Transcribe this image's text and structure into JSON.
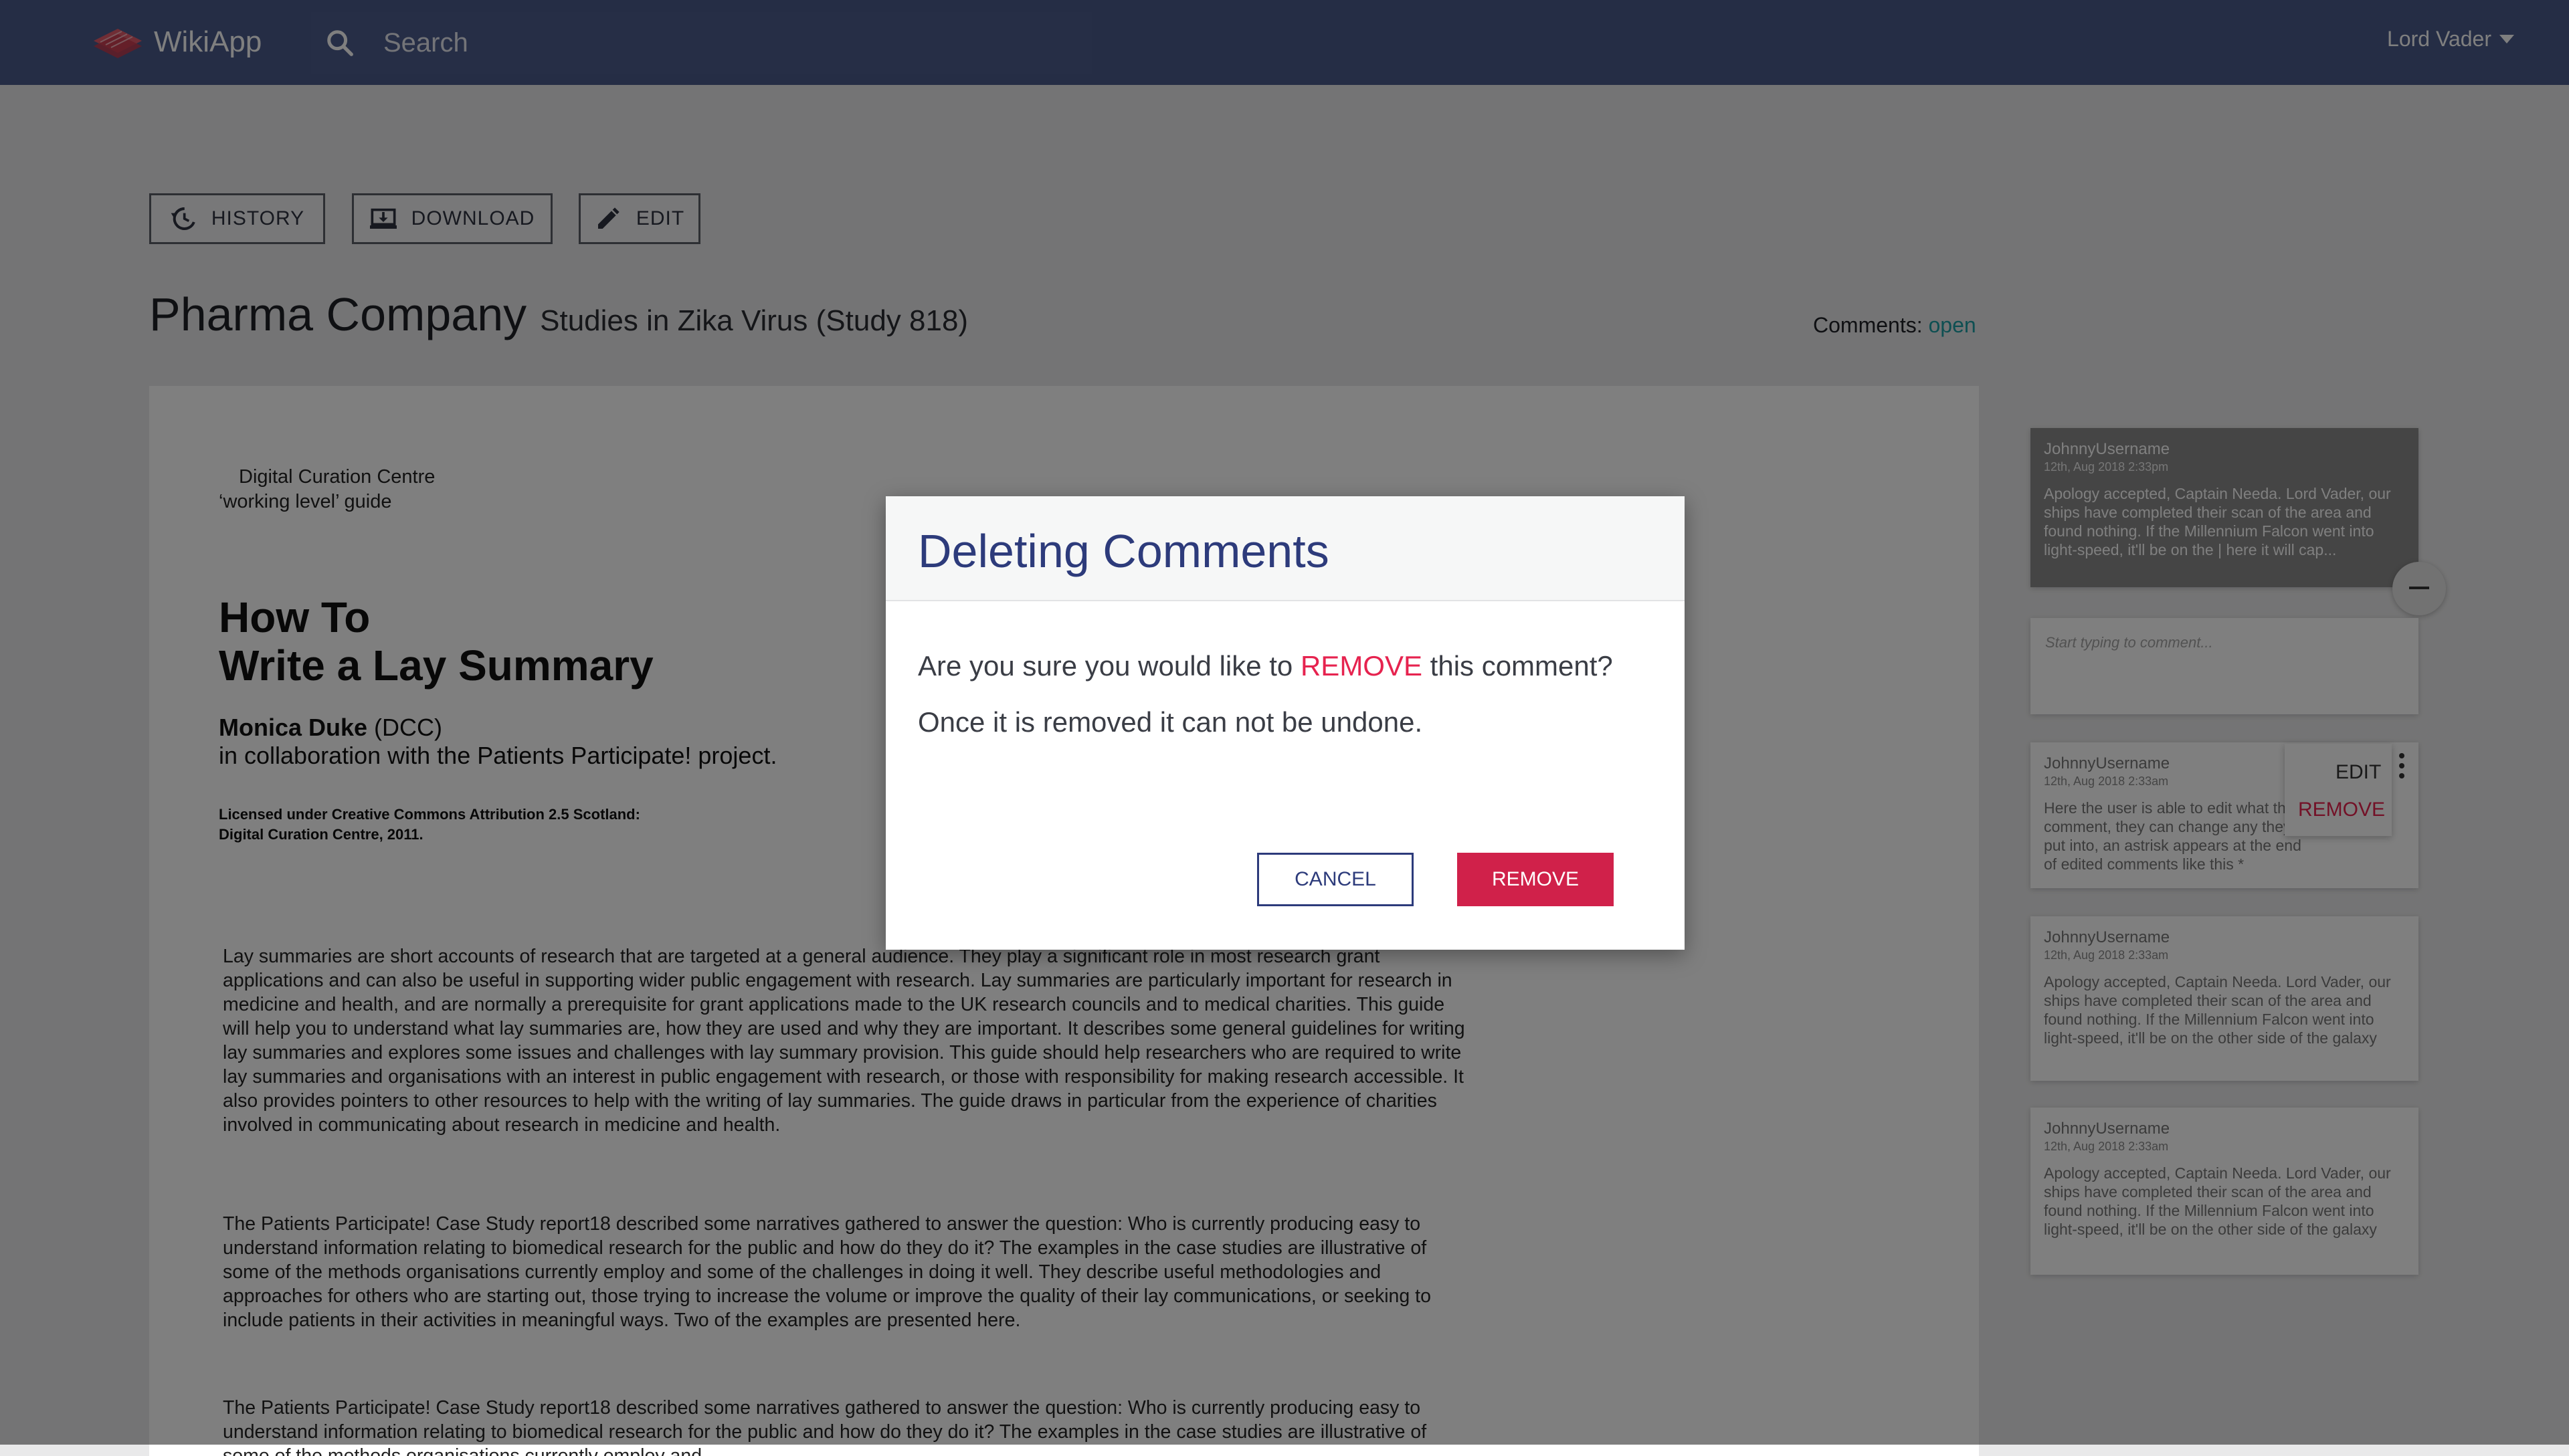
{
  "topbar": {
    "app_name": "WikiApp",
    "search_placeholder": "Search",
    "user_name": "Lord Vader"
  },
  "toolbar": {
    "history_label": "HISTORY",
    "download_label": "DOWNLOAD",
    "edit_label": "EDIT"
  },
  "page": {
    "title": "Pharma Company",
    "subtitle": "Studies in Zika Virus (Study 818)",
    "comments_label": "Comments:",
    "comments_status": "open"
  },
  "document": {
    "org_line1": "Digital Curation Centre",
    "org_line2": "‘working level’ guide",
    "title_line1": "How To",
    "title_line2": "Write a Lay Summary",
    "author_name": "Monica Duke",
    "author_org": " (DCC)",
    "collab": "in collaboration with the Patients Participate! project.",
    "license_line1": "Licensed under Creative Commons Attribution 2.5 Scotland:",
    "license_line2": "Digital Curation Centre, 2011.",
    "paragraphs": [
      "Lay summaries are short accounts of research that are targeted at a general audience. They play a significant role in most research grant applications and can also be useful in supporting wider public engagement with research. Lay summaries are particularly important for research in medicine and health, and are normally a prerequisite for grant applications made to the UK research councils and to medical charities. This guide will help you to understand what lay summaries are, how they are used and why they are important. It describes some general guidelines for writing lay summaries and explores some issues and challenges with lay summary provision. This guide should help researchers who are required to write lay summaries and organisations with an interest in public engagement with research, or those with responsibility for making research accessible. It also provides pointers to other resources to help with the writing of lay summaries. The guide draws in particular from the experience of charities involved in communicating about research in medicine and health.",
      "The Patients Participate! Case Study report18 described some narratives gathered to answer the question: Who is currently producing easy to understand information relating to biomedical research for the public and how do they do it? The examples in the case studies are illustrative of some of the methods organisations currently employ and some of the challenges in doing it well. They describe useful methodologies and approaches for others who are starting out, those trying to increase the volume or improve the quality of their lay communications, or seeking to include patients in their activities in meaningful ways. Two of the examples are presented here.",
      "The Patients Participate! Case Study report18 described some narratives gathered to answer the question: Who is currently producing easy to understand information relating to biomedical research for the public and how do they do it? The examples in the case studies are illustrative of some of the methods organisations currently employ and"
    ]
  },
  "comments": {
    "reply_placeholder": "Start typing to comment...",
    "menu_edit": "EDIT",
    "menu_remove": "REMOVE",
    "items": [
      {
        "user": "JohnnyUsername",
        "date": "12th, Aug 2018 2:33pm",
        "text": "Apology accepted, Captain Needa. Lord Vader, our ships have completed their scan of the area and found nothing. If the Millennium Falcon went into light-speed, it'll be on the | here it will cap..."
      },
      {
        "user": "JohnnyUsername",
        "date": "12th, Aug 2018 2:33am",
        "text": "Here the user is able to edit what the comment, they can change any they put into, an astrisk appears at the end of edited comments like this *"
      },
      {
        "user": "JohnnyUsername",
        "date": "12th, Aug 2018 2:33am",
        "text": "Apology accepted, Captain Needa. Lord Vader, our ships have completed their scan of the area and found nothing. If the Millennium Falcon went into light-speed, it'll be on the other side of the galaxy"
      },
      {
        "user": "JohnnyUsername",
        "date": "12th, Aug 2018 2:33am",
        "text": "Apology accepted, Captain Needa. Lord Vader, our ships have completed their scan of the area and found nothing. If the Millennium Falcon went into light-speed, it'll be on the other side of the galaxy"
      }
    ]
  },
  "modal": {
    "title": "Deleting Comments",
    "line1_pre": "Are you sure you would like to ",
    "line1_hl": "REMOVE",
    "line1_post": " this comment?",
    "line2": "Once it is removed it can not be undone.",
    "cancel_label": "CANCEL",
    "remove_label": "REMOVE"
  },
  "colors": {
    "topbar": "#4a5a8a",
    "accent_blue": "#2d3b7b",
    "danger": "#d0214a",
    "open_status": "#1d9fa5"
  }
}
